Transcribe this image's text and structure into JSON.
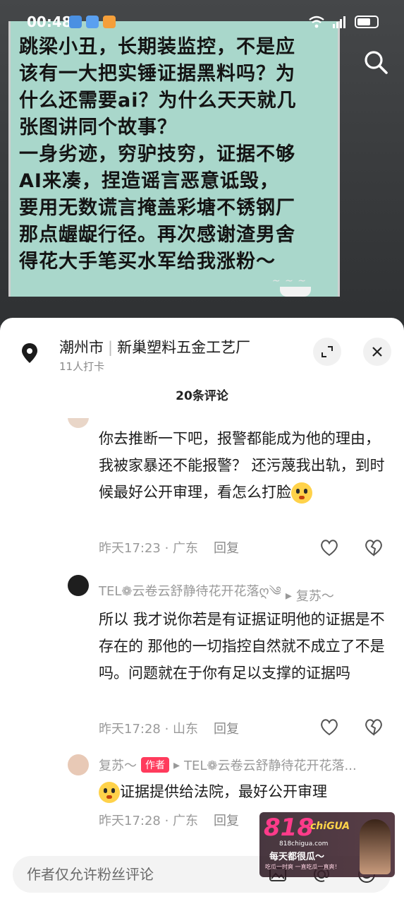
{
  "status_bar": {
    "time": "00:48"
  },
  "post_text_lines": [
    "跳梁小丑，长期装监控，不是应",
    "该有一大把实锤证据黑料吗？为",
    "什么还需要ai？为什么天天就几",
    "张图讲同个故事？",
    "一身劣迹，穷驴技穷，证据不够",
    "AI来凑，捏造谣言恶意诋毁，",
    "要用无数谎言掩盖彩塘不锈钢厂",
    "那点龌龊行径。再次感谢渣男舍",
    "得花大手笔买水军给我涨粉～"
  ],
  "location": {
    "city": "潮州市",
    "separator": "|",
    "place": "新巢塑料五金工艺厂",
    "checkins": "11人打卡"
  },
  "comment_count": "20条评论",
  "comments": [
    {
      "text": "你去推断一下吧，报警都能成为他的理由，我被家暴还不能报警？ 还污蔑我出轨，到时候最好公开审理，看怎么打脸",
      "time": "昨天17:23",
      "region": "广东",
      "reply": "回复"
    },
    {
      "user": "TEL❁云卷云舒静待花开花落ღ༄",
      "arrow": "▸",
      "reply_to": "复苏～",
      "text": "所以 我才说你若是有证据证明他的证据是不存在的 那他的一切指控自然就不成立了不是吗。问题就在于你有足以支撑的证据吗",
      "time": "昨天17:28",
      "region": "山东",
      "reply": "回复"
    },
    {
      "user": "复苏～",
      "author_tag": "作者",
      "arrow": "▸",
      "reply_to": "TEL❁云卷云舒静待花开花落...",
      "text": "证据提供给法院，最好公开审理",
      "time": "昨天17:28",
      "region": "广东",
      "reply": "回复"
    }
  ],
  "input": {
    "placeholder": "作者仅允许粉丝评论"
  },
  "watermark": {
    "brand": "818",
    "brand_sub": "chiGUA",
    "url": "818chigua.com",
    "slogan": "每天都很瓜～",
    "tagline": "吃瓜一时爽 一直吃瓜一直爽！"
  },
  "colors": {
    "accent": "#ff3b5c",
    "note_bg": "#a9d7cb",
    "sheet_bg": "#ffffff"
  }
}
